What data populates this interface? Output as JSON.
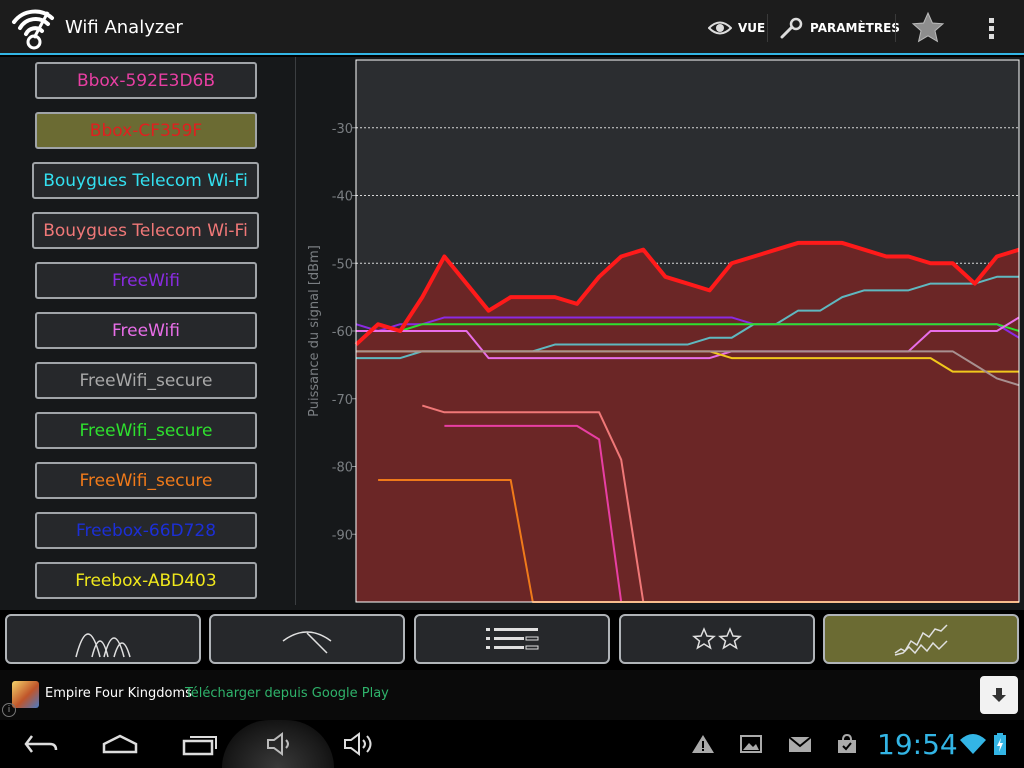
{
  "app": {
    "title": "Wifi Analyzer",
    "accent_color": "#33b5e5",
    "icon": "wifi-analyzer-app-icon"
  },
  "actionbar": {
    "view_label": "VUE",
    "view_icon": "eye-icon",
    "settings_label": "PARAMÈTRES",
    "settings_icon": "wrench-icon",
    "favorite_icon": "star-icon",
    "overflow_icon": "overflow-menu-icon"
  },
  "networks": [
    {
      "ssid": "Bbox-592E3D6B",
      "color": "#e83fa3",
      "selected": false
    },
    {
      "ssid": "Bbox-CF359F",
      "color": "#e01f1f",
      "selected": true
    },
    {
      "ssid": "Bouygues Telecom Wi-Fi",
      "color": "#33e0f0",
      "selected": false
    },
    {
      "ssid": "Bouygues Telecom Wi-Fi",
      "color": "#f07878",
      "selected": false
    },
    {
      "ssid": "FreeWifi",
      "color": "#8a2be2",
      "selected": false
    },
    {
      "ssid": "FreeWifi",
      "color": "#e86ee8",
      "selected": false
    },
    {
      "ssid": "FreeWifi_secure",
      "color": "#a8a8a8",
      "selected": false
    },
    {
      "ssid": "FreeWifi_secure",
      "color": "#2ee02e",
      "selected": false
    },
    {
      "ssid": "FreeWifi_secure",
      "color": "#f07a1a",
      "selected": false
    },
    {
      "ssid": "Freebox-66D728",
      "color": "#1c2fd6",
      "selected": false
    },
    {
      "ssid": "Freebox-ABD403",
      "color": "#f0e81c",
      "selected": false
    }
  ],
  "chart_data": {
    "type": "line",
    "ylabel": "Puissance du signal [dBm]",
    "yticks": [
      -30,
      -40,
      -50,
      -60,
      -70,
      -80,
      -90
    ],
    "ylim": [
      -100,
      -20
    ],
    "grid": true,
    "background_color": "#2b2d30",
    "fill_color": "#6b2626",
    "x": [
      0,
      1,
      2,
      3,
      4,
      5,
      6,
      7,
      8,
      9,
      10,
      11,
      12,
      13,
      14,
      15,
      16,
      17,
      18,
      19,
      20,
      21,
      22,
      23,
      24,
      25,
      26,
      27,
      28,
      29,
      30
    ],
    "series": [
      {
        "name": "Bbox-CF359F",
        "color": "#ff1a1a",
        "width": 4,
        "filled": true,
        "values": [
          -62,
          -59,
          -60,
          -55,
          -49,
          -53,
          -57,
          -55,
          -55,
          -55,
          -56,
          -52,
          -49,
          -48,
          -52,
          -53,
          -54,
          -50,
          -49,
          -48,
          -47,
          -47,
          -47,
          -48,
          -49,
          -49,
          -50,
          -50,
          -53,
          -49,
          -48
        ]
      },
      {
        "name": "Bouygues Telecom Wi-Fi",
        "color": "#5fb8c0",
        "width": 2,
        "values": [
          -64,
          -64,
          -64,
          -63,
          -63,
          -63,
          -63,
          -63,
          -63,
          -62,
          -62,
          -62,
          -62,
          -62,
          -62,
          -62,
          -61,
          -61,
          -59,
          -59,
          -57,
          -57,
          -55,
          -54,
          -54,
          -54,
          -53,
          -53,
          -53,
          -52,
          -52
        ]
      },
      {
        "name": "FreeWifi",
        "color": "#8a2be2",
        "width": 2,
        "values": [
          -59,
          -60,
          -59,
          -59,
          -58,
          -58,
          -58,
          -58,
          -58,
          -58,
          -58,
          -58,
          -58,
          -58,
          -58,
          -58,
          -58,
          -58,
          -59,
          -59,
          -59,
          -59,
          -59,
          -59,
          -59,
          -59,
          -59,
          -59,
          -59,
          -59,
          -61
        ]
      },
      {
        "name": "FreeWifi_secure",
        "color": "#2ee02e",
        "width": 2,
        "values": [
          -60,
          -60,
          -60,
          -59,
          -59,
          -59,
          -59,
          -59,
          -59,
          -59,
          -59,
          -59,
          -59,
          -59,
          -59,
          -59,
          -59,
          -59,
          -59,
          -59,
          -59,
          -59,
          -59,
          -59,
          -59,
          -59,
          -59,
          -59,
          -59,
          -59,
          -60
        ]
      },
      {
        "name": "FreeWifi (2)",
        "color": "#e86ee8",
        "width": 2,
        "values": [
          -60,
          -60,
          -60,
          -60,
          -60,
          -60,
          -64,
          -64,
          -64,
          -64,
          -64,
          -64,
          -64,
          -64,
          -64,
          -64,
          -64,
          -63,
          -63,
          -63,
          -63,
          -63,
          -63,
          -63,
          -63,
          -63,
          -60,
          -60,
          -60,
          -60,
          -58
        ]
      },
      {
        "name": "Freebox-ABD403",
        "color": "#f0c81c",
        "width": 2,
        "values": [
          -63,
          -63,
          -63,
          -63,
          -63,
          -63,
          -63,
          -63,
          -63,
          -63,
          -63,
          -63,
          -63,
          -63,
          -63,
          -63,
          -63,
          -64,
          -64,
          -64,
          -64,
          -64,
          -64,
          -64,
          -64,
          -64,
          -64,
          -66,
          -66,
          -66,
          -66
        ]
      },
      {
        "name": "FreeWifi_secure (2)",
        "color": "#a89090",
        "width": 2,
        "values": [
          -63,
          -63,
          -63,
          -63,
          -63,
          -63,
          -63,
          -63,
          -63,
          -63,
          -63,
          -63,
          -63,
          -63,
          -63,
          -63,
          -63,
          -63,
          -63,
          -63,
          -63,
          -63,
          -63,
          -63,
          -63,
          -63,
          -63,
          -63,
          -65,
          -67,
          -68
        ]
      },
      {
        "name": "Bbox-592E3D6B",
        "color": "#e83fa3",
        "width": 2,
        "values": [
          null,
          null,
          null,
          null,
          -74,
          -74,
          -74,
          -74,
          -74,
          -74,
          -74,
          -76,
          -100,
          -100,
          -100,
          -100,
          -100,
          -100,
          -100,
          -100,
          -100,
          -100,
          -100,
          -100,
          -100,
          -100,
          -100,
          -100,
          -100,
          -100,
          -100
        ]
      },
      {
        "name": "Bouygues Telecom Wi-Fi (2)",
        "color": "#f07878",
        "width": 2,
        "values": [
          null,
          null,
          null,
          -71,
          -72,
          -72,
          -72,
          -72,
          -72,
          -72,
          -72,
          -72,
          -79,
          -100,
          -100,
          -100,
          -100,
          -100,
          -100,
          -100,
          -100,
          -100,
          -100,
          -100,
          -100,
          -100,
          -100,
          -100,
          -100,
          -100,
          -100
        ]
      },
      {
        "name": "FreeWifi_secure (3)",
        "color": "#f07a1a",
        "width": 2,
        "values": [
          null,
          -82,
          -82,
          -82,
          -82,
          -82,
          -82,
          -82,
          -100,
          -100,
          -100,
          -100,
          -100,
          -100,
          -100,
          -100,
          -100,
          -100,
          -100,
          -100,
          -100,
          -100,
          -100,
          -100,
          -100,
          -100,
          -100,
          -100,
          -100,
          -100,
          -100
        ]
      }
    ]
  },
  "tabs": [
    {
      "name": "channel-graph",
      "icon": "channel-graph-icon",
      "active": false
    },
    {
      "name": "signal-meter",
      "icon": "signal-meter-icon",
      "active": false
    },
    {
      "name": "ap-list",
      "icon": "ap-list-icon",
      "active": false
    },
    {
      "name": "channel-rating",
      "icon": "channel-rating-icon",
      "active": false
    },
    {
      "name": "time-graph",
      "icon": "time-graph-icon",
      "active": true
    }
  ],
  "ad": {
    "title": "Empire Four Kingdoms",
    "subtitle": "Télécharger depuis Google Play",
    "icon": "game-icon",
    "action_icon": "download-icon"
  },
  "system_bar": {
    "time": "19:54",
    "nav_icons": [
      "back-icon",
      "home-icon",
      "recent-apps-icon",
      "volume-down-icon",
      "volume-up-icon"
    ],
    "status_icons": [
      "warning-icon",
      "gallery-icon",
      "gmail-icon",
      "store-icon",
      "wifi-icon",
      "battery-icon"
    ]
  }
}
